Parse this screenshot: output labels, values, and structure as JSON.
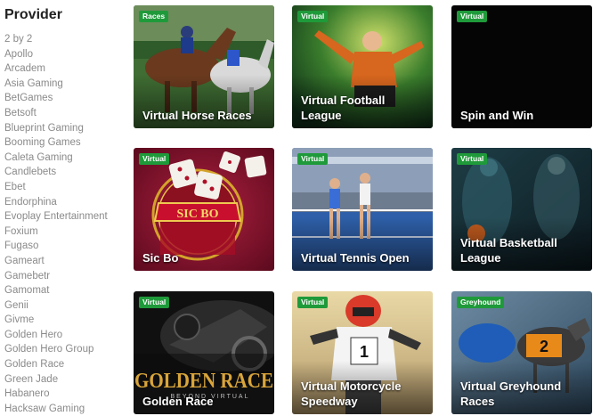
{
  "sidebar": {
    "heading": "Provider",
    "providers": [
      "2 by 2",
      "Apollo",
      "Arcadem",
      "Asia Gaming",
      "BetGames",
      "Betsoft",
      "Blueprint Gaming",
      "Booming Games",
      "Caleta Gaming",
      "Candlebets",
      "Ebet",
      "Endorphina",
      "Evoplay Entertainment",
      "Foxium",
      "Fugaso",
      "Gameart",
      "Gamebetr",
      "Gamomat",
      "Genii",
      "Givme",
      "Golden Hero",
      "Golden Hero Group",
      "Golden Race",
      "Green Jade",
      "Habanero",
      "Hacksaw Gaming"
    ]
  },
  "games": [
    {
      "badge": "Races",
      "title": "Virtual Horse Races",
      "art": "horse-racing-icon"
    },
    {
      "badge": "Virtual",
      "title": "Virtual Football League",
      "art": "football-player-icon"
    },
    {
      "badge": "Virtual",
      "title": "Spin and Win",
      "art": "black-thumbnail"
    },
    {
      "badge": "Virtual",
      "title": "Sic Bo",
      "art": "dice-icon",
      "logo": "SIC BO"
    },
    {
      "badge": "Virtual",
      "title": "Virtual Tennis Open",
      "art": "tennis-icon"
    },
    {
      "badge": "Virtual",
      "title": "Virtual Basketball League",
      "art": "basketball-icon"
    },
    {
      "badge": "Virtual",
      "title": "Golden Race",
      "art": "motorbike-icon",
      "logo": "GOLDEN RACE",
      "logo_sub": "BEYOND VIRTUAL"
    },
    {
      "badge": "Virtual",
      "title": "Virtual Motorcycle Speedway",
      "art": "speedway-rider-icon",
      "bib": "1"
    },
    {
      "badge": "Greyhound",
      "title": "Virtual Greyhound Races",
      "art": "greyhound-icon",
      "bib": "2"
    }
  ],
  "colors": {
    "badge": "#1f9a3a",
    "sidebar_text": "#8a8a8a",
    "heading": "#222222"
  }
}
